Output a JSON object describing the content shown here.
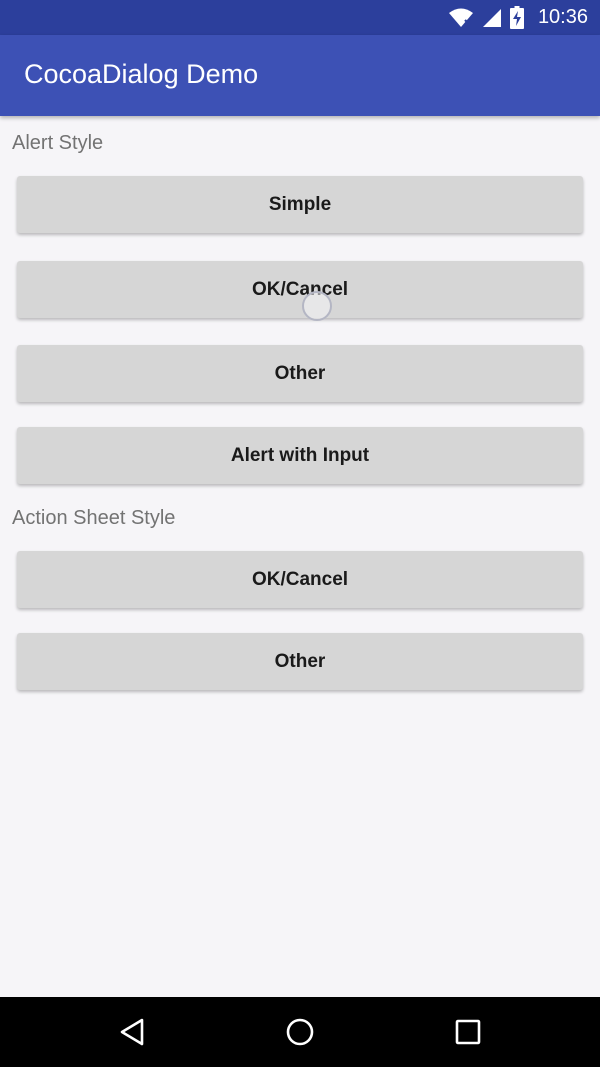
{
  "status_bar": {
    "time": "10:36",
    "wifi_icon": "wifi-icon",
    "signal_icon": "signal-icon",
    "battery_icon": "battery-charging-icon",
    "background_color": "#2c3f9c"
  },
  "app_bar": {
    "title": "CocoaDialog Demo",
    "background_color": "#3d51b5"
  },
  "alert_section": {
    "label": "Alert Style",
    "buttons": [
      {
        "label": "Simple"
      },
      {
        "label": "OK/Cancel"
      },
      {
        "label": "Other"
      },
      {
        "label": "Alert with Input"
      }
    ]
  },
  "action_sheet_section": {
    "label": "Action Sheet Style",
    "buttons": [
      {
        "label": "OK/Cancel"
      },
      {
        "label": "Other"
      }
    ]
  },
  "nav_bar": {
    "back_icon": "back-triangle-icon",
    "home_icon": "home-circle-icon",
    "recents_icon": "recents-square-icon"
  },
  "colors": {
    "button_background": "#d6d6d6",
    "page_background": "#f6f5f8",
    "section_label": "#737373"
  }
}
